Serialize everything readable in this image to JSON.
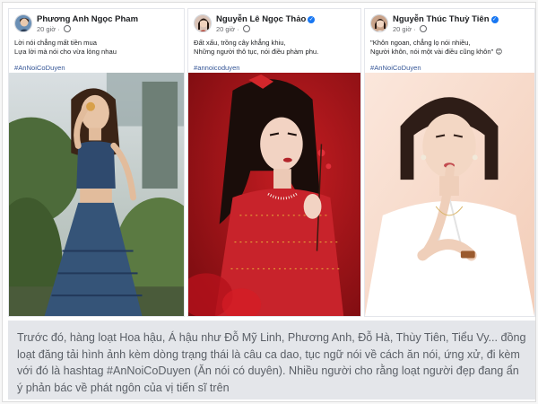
{
  "posts": [
    {
      "author": "Phương Anh Ngọc Pham",
      "time": "20 giờ",
      "caption_lines": [
        "Lời nói chẳng mất tiền mua",
        "Lựa lời mà nói cho vừa lòng nhau"
      ],
      "hashtag": "#AnNoiCoDuyen",
      "verified": false
    },
    {
      "author": "Nguyễn Lê Ngọc Thảo",
      "time": "20 giờ",
      "caption_lines": [
        "Đất xấu, trồng cây khẳng khiu,",
        "Những người thô tục, nói điều phàm phu."
      ],
      "hashtag": "#annoicoduyen",
      "verified": true
    },
    {
      "author": "Nguyễn Thúc Thuỳ Tiên",
      "time": "20 giờ",
      "caption_lines": [
        "\"Khôn ngoan, chẳng lọ nói nhiều,",
        "Người khôn, nói một vài điều cũng khôn\" 😊"
      ],
      "hashtag": "#AnNoiCoDuyen",
      "verified": true
    }
  ],
  "article": {
    "text": "Trước đó, hàng loạt Hoa hậu, Á hậu như Đỗ Mỹ Linh, Phương Anh, Đỗ Hà, Thùy Tiên, Tiểu Vy... đồng loạt đăng tải hình ảnh kèm dòng trạng thái là câu ca dao, tục ngữ nói về cách ăn nói, ứng xử, đi kèm với đó là hashtag #AnNoiCoDuyen (Ăn nói có duyên). Nhiều người cho rằng loạt người đẹp đang ẩn ý phản bác về phát ngôn của vị tiến sĩ trên"
  },
  "colors": {
    "link": "#385898",
    "verified": "#1877f2",
    "article_bg": "#e4e6ea",
    "article_text": "#5a5f66"
  }
}
